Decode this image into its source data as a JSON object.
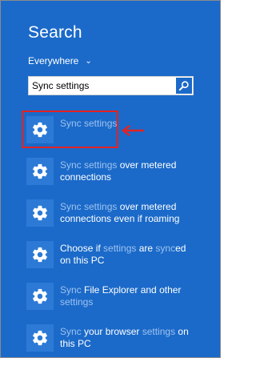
{
  "search_pane": {
    "title": "Search",
    "scope": "Everywhere",
    "query": "Sync settings"
  },
  "results": [
    {
      "icon": "gear-icon",
      "parts": [
        {
          "text": "Sync settings",
          "hl": true
        }
      ]
    },
    {
      "icon": "gear-icon",
      "parts": [
        {
          "text": "Sync settings",
          "hl": true
        },
        {
          "text": " over metered connections",
          "hl": false
        }
      ]
    },
    {
      "icon": "gear-icon",
      "parts": [
        {
          "text": "Sync settings",
          "hl": true
        },
        {
          "text": " over metered connections even if roaming",
          "hl": false
        }
      ]
    },
    {
      "icon": "gear-icon",
      "parts": [
        {
          "text": "Choose if ",
          "hl": false
        },
        {
          "text": "settings",
          "hl": true
        },
        {
          "text": " are ",
          "hl": false
        },
        {
          "text": "sync",
          "hl": true
        },
        {
          "text": "ed on this PC",
          "hl": false
        }
      ]
    },
    {
      "icon": "gear-icon",
      "parts": [
        {
          "text": "Sync",
          "hl": true
        },
        {
          "text": " File Explorer and other ",
          "hl": false
        },
        {
          "text": "settings",
          "hl": true
        }
      ]
    },
    {
      "icon": "gear-icon",
      "parts": [
        {
          "text": "Sync",
          "hl": true
        },
        {
          "text": " your browser ",
          "hl": false
        },
        {
          "text": "settings",
          "hl": true
        },
        {
          "text": " on this PC",
          "hl": false
        }
      ]
    }
  ],
  "colors": {
    "pane_bg": "#1b6ac9",
    "tile_bg": "#2c7ad6",
    "match_text": "#9ec2ef",
    "annotation": "#e32222"
  }
}
